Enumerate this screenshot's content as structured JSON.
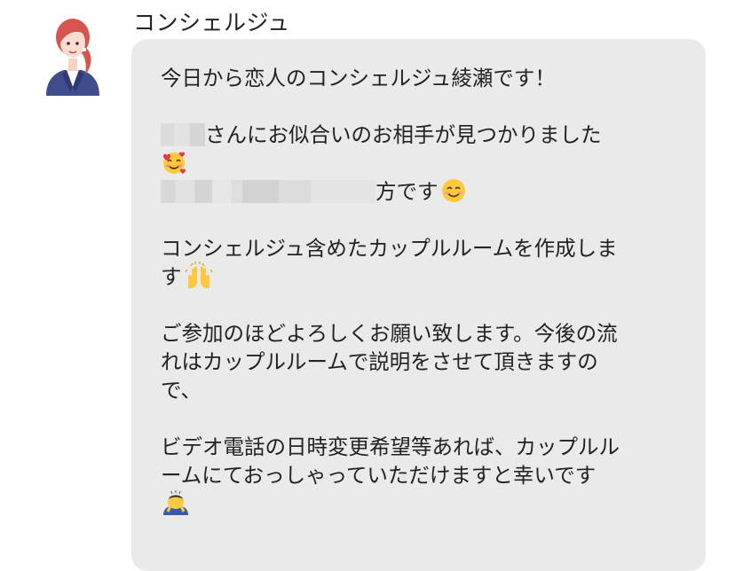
{
  "sender": {
    "name": "コンシェルジュ"
  },
  "message": {
    "line1": "今日から恋人のコンシェルジュ綾瀬です！",
    "line2_text": "さんにお似合いのお相手が見つかりました",
    "line3_text": "方です",
    "line4": "コンシェルジュ含めたカップルルームを作成しま",
    "line5_text": "す",
    "line6": "ご参加のほどよろしくお願い致します。今後の流",
    "line7": "れはカップルルームで説明をさせて頂きますの",
    "line8": "で、",
    "line9": "ビデオ電話の日時変更希望等あれば、カップルル",
    "line10": "ームにておっしゃっていただけますと幸いです",
    "emojis": [
      "smiling-face-with-hearts",
      "smiling-face-with-smiling-eyes",
      "raising-hands",
      "person-bowing"
    ]
  }
}
